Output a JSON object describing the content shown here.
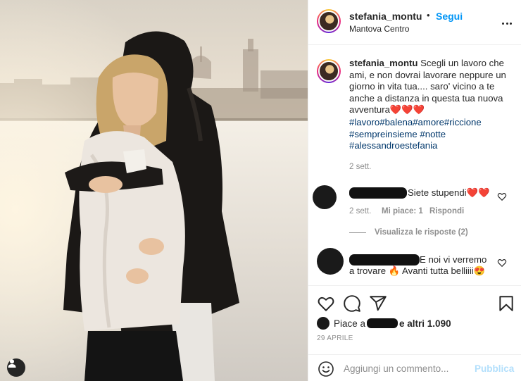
{
  "post": {
    "author": "stefania_montu",
    "separator": "•",
    "follow_label": "Segui",
    "location": "Mantova Centro",
    "caption": "Scegli un lavoro che ami, e non dovrai lavorare neppure un giorno in vita tua.... saro' vicino a te anche a distanza in questa tua nuova avventura❤️❤️❤️",
    "hashtags": [
      "#lavoro",
      "#balena",
      "#amore",
      "#riccione",
      "#sempreinsieme",
      "#notte",
      "#alessandroestefania"
    ],
    "caption_age": "2 sett."
  },
  "comments": [
    {
      "text": "Siete stupendi❤️❤️",
      "age": "2 sett.",
      "likes_label": "Mi piace: 1",
      "reply_label": "Rispondi",
      "view_replies_label": "Visualizza le risposte (2)"
    },
    {
      "text_line1": "E noi vi verremo",
      "text_line2": "a trovare 🔥 Avanti tutta belliiii😍"
    }
  ],
  "likes": {
    "prefix": "Piace a",
    "suffix": "e altri 1.090"
  },
  "post_date": "29 APRILE",
  "comment_box": {
    "placeholder": "Aggiungi un commento...",
    "publish_label": "Pubblica"
  },
  "colors": {
    "accent_blue": "#0095f6",
    "publish_disabled": "#b2dffc",
    "hashtag": "#00376b",
    "muted": "#8e8e8e",
    "text": "#262626"
  },
  "icons": [
    "user-tag-icon",
    "more-icon",
    "heart-icon",
    "comment-icon",
    "share-icon",
    "bookmark-icon",
    "emoji-icon"
  ]
}
